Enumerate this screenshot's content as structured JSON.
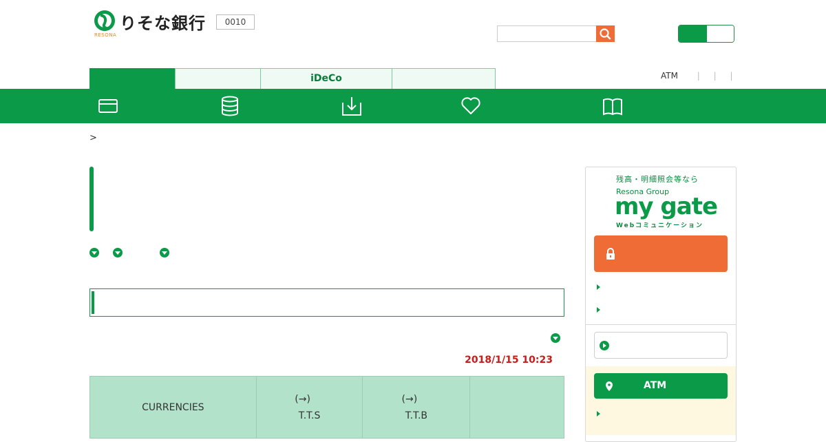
{
  "header": {
    "bank_name": "りそな銀行",
    "bank_name_en": "RESONA",
    "bank_code": "0010",
    "search": {
      "placeholder": "",
      "value": ""
    }
  },
  "tabs": [
    {
      "label": "",
      "active": true
    },
    {
      "label": "",
      "active": false
    },
    {
      "label": "iDeCo",
      "active": false
    },
    {
      "label": "",
      "active": false
    }
  ],
  "utility_links": {
    "atm": "ATM"
  },
  "nav_icons": [
    "card-icon",
    "coins-stack-icon",
    "download-icon",
    "heart-icon",
    "book-icon"
  ],
  "breadcrumb": {
    "separator": ">"
  },
  "rates": {
    "timestamp": "2018/1/15 10:23",
    "columns": [
      {
        "line1": "CURRENCIES",
        "line2": ""
      },
      {
        "line1": "(→)",
        "line2": "T.T.S"
      },
      {
        "line1": "(→)",
        "line2": "T.T.B"
      },
      {
        "line1": "",
        "line2": ""
      }
    ]
  },
  "sidebar": {
    "tagline": "残高・明細照会等なら",
    "group": "Resona Group",
    "brand": "my gate",
    "brand_sub": "Webコミュニケーション",
    "atm_label": "ATM"
  },
  "colors": {
    "brand_green": "#0a9a48",
    "accent_orange": "#ef6c37",
    "timestamp_red": "#cc1a1a",
    "table_header": "#b3e2cb"
  }
}
